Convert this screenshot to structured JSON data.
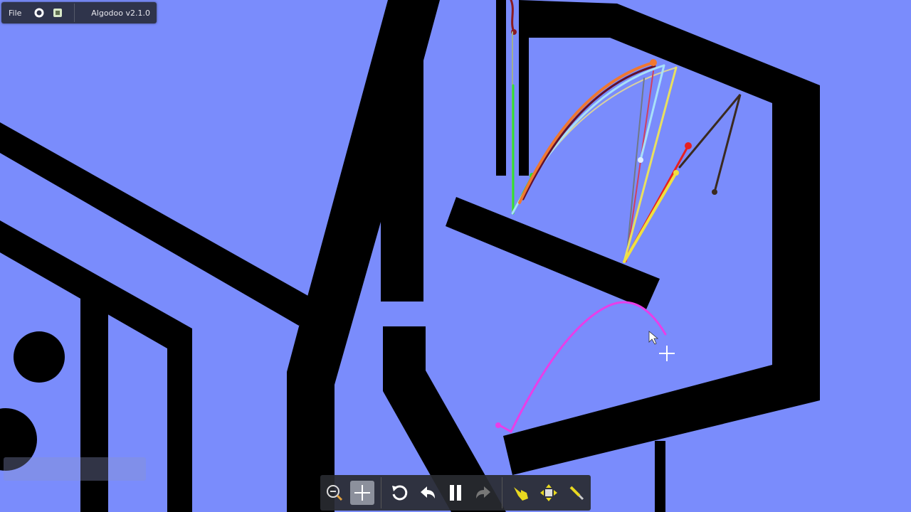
{
  "app": {
    "version_label": "Algodoo v2.1.0"
  },
  "top_toolbar": {
    "file_label": "File",
    "icons": [
      "settings-icon",
      "window-icon"
    ]
  },
  "bottom_toolbar": {
    "buttons": [
      {
        "name": "zoom-icon",
        "active": false
      },
      {
        "name": "pan-icon",
        "active": true
      },
      {
        "name": "reset-icon",
        "active": false
      },
      {
        "name": "undo-icon",
        "active": false
      },
      {
        "name": "pause-icon",
        "active": false
      },
      {
        "name": "redo-icon",
        "active": false,
        "disabled": true
      },
      {
        "name": "drag-tool-icon",
        "active": false
      },
      {
        "name": "move-tool-icon",
        "active": false
      },
      {
        "name": "sketch-tool-icon",
        "active": false
      }
    ]
  },
  "colors": {
    "background": "#7a8cfc",
    "solid": "#000000",
    "trace_magenta": "#e83ee8",
    "trace_orange": "#f07830",
    "trace_light_blue": "#a8e0f8",
    "trace_yellow": "#f0e040",
    "trace_red": "#e82020",
    "trace_green": "#30e030",
    "trace_brown": "#3a2a20"
  }
}
